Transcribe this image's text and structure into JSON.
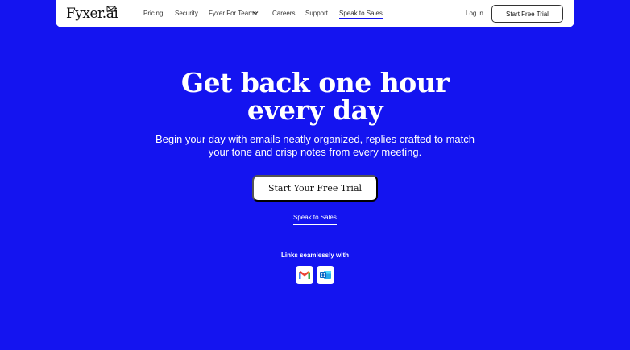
{
  "nav": {
    "logo": "Fyxer.ai",
    "links": [
      "Pricing",
      "Security",
      "Fyxer For Teams",
      "Careers",
      "Support",
      "Speak to Sales"
    ],
    "login": "Log in",
    "trial_button": "Start Free Trial"
  },
  "hero": {
    "title_line1": "Get back one hour",
    "title_line2": "every day",
    "subtitle_line1": "Begin your day with emails neatly organized, replies crafted to match",
    "subtitle_line2": "your tone and crisp notes from every meeting.",
    "cta": "Start Your Free Trial",
    "speak_link": "Speak to Sales",
    "links_label": "Links seamlessly with"
  },
  "integrations": [
    {
      "icon": "gmail-icon"
    },
    {
      "icon": "outlook-icon"
    }
  ],
  "colors": {
    "background": "#1414f0",
    "white": "#ffffff"
  }
}
